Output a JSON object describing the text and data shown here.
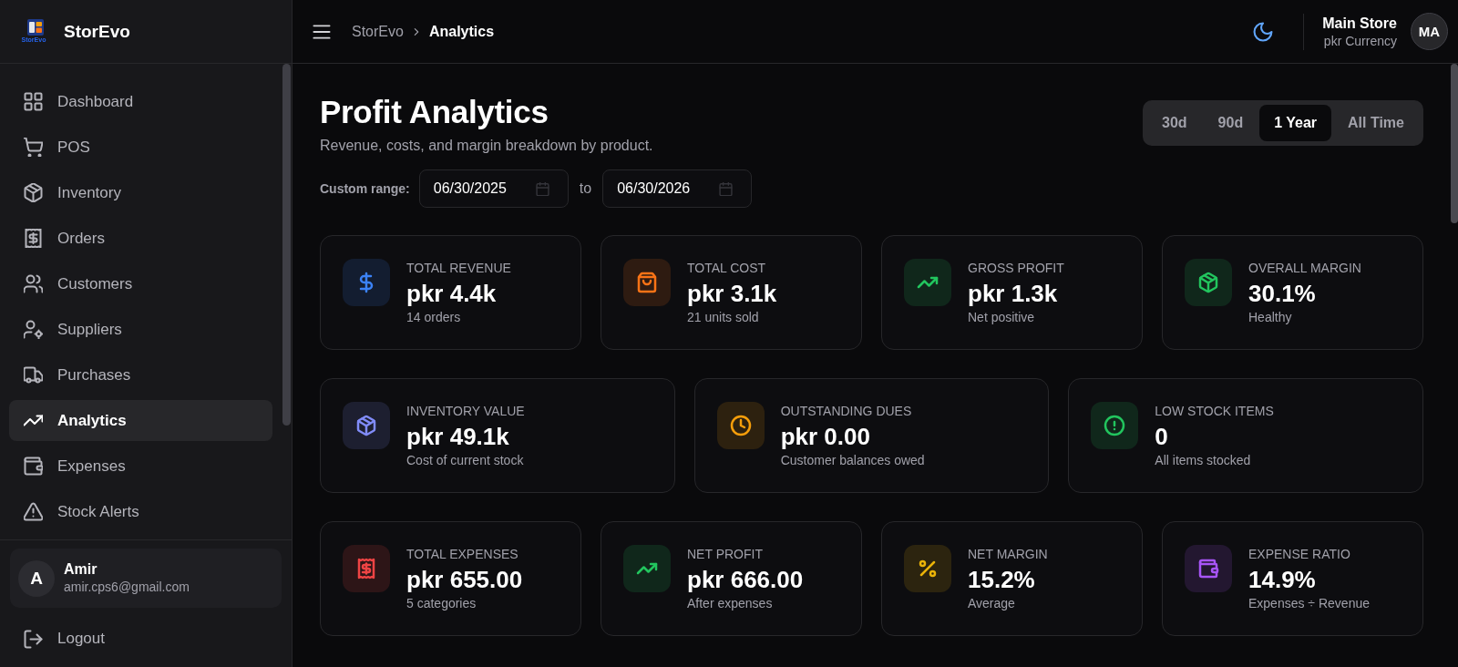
{
  "sidebar": {
    "brand": {
      "logo_caption": "StorEvo",
      "name": "StorEvo"
    },
    "nav": [
      {
        "label": "Dashboard",
        "selected": false
      },
      {
        "label": "POS",
        "selected": false
      },
      {
        "label": "Inventory",
        "selected": false
      },
      {
        "label": "Orders",
        "selected": false
      },
      {
        "label": "Customers",
        "selected": false
      },
      {
        "label": "Suppliers",
        "selected": false
      },
      {
        "label": "Purchases",
        "selected": false
      },
      {
        "label": "Analytics",
        "selected": true
      },
      {
        "label": "Expenses",
        "selected": false
      },
      {
        "label": "Stock Alerts",
        "selected": false
      }
    ],
    "user": {
      "initial": "A",
      "name": "Amir",
      "email": "amir.cps6@gmail.com"
    },
    "logout": "Logout"
  },
  "header": {
    "breadcrumb": [
      "StorEvo",
      "Analytics"
    ],
    "store": {
      "name": "Main Store",
      "currency": "pkr Currency"
    },
    "avatar": "MA"
  },
  "page": {
    "title": "Profit Analytics",
    "subtitle": "Revenue, costs, and margin breakdown by product.",
    "custom_range": {
      "label": "Custom range:",
      "from": "06/30/2025",
      "separator": "to",
      "to": "06/30/2026"
    },
    "periods": [
      {
        "label": "30d",
        "selected": false
      },
      {
        "label": "90d",
        "selected": false
      },
      {
        "label": "1 Year",
        "selected": true
      },
      {
        "label": "All Time",
        "selected": false
      }
    ]
  },
  "metric_rows": [
    {
      "cards": [
        {
          "label": "TOTAL REVENUE",
          "value": "pkr 4.4k",
          "note": "14 orders",
          "color": "#3b82f6"
        },
        {
          "label": "TOTAL COST",
          "value": "pkr 3.1k",
          "note": "21 units sold",
          "color": "#f97316"
        },
        {
          "label": "GROSS PROFIT",
          "value": "pkr 1.3k",
          "note": "Net positive",
          "color": "#22c55e"
        },
        {
          "label": "OVERALL MARGIN",
          "value": "30.1%",
          "note": "Healthy",
          "color": "#22c55e"
        }
      ]
    },
    {
      "cards": [
        {
          "label": "INVENTORY VALUE",
          "value": "pkr 49.1k",
          "note": "Cost of current stock",
          "color": "#818cf8"
        },
        {
          "label": "OUTSTANDING DUES",
          "value": "pkr 0.00",
          "note": "Customer balances owed",
          "color": "#f59e0b"
        },
        {
          "label": "LOW STOCK ITEMS",
          "value": "0",
          "note": "All items stocked",
          "color": "#22c55e"
        }
      ]
    },
    {
      "cards": [
        {
          "label": "TOTAL EXPENSES",
          "value": "pkr 655.00",
          "note": "5 categories",
          "color": "#ef4444"
        },
        {
          "label": "NET PROFIT",
          "value": "pkr 666.00",
          "note": "After expenses",
          "color": "#22c55e"
        },
        {
          "label": "NET MARGIN",
          "value": "15.2%",
          "note": "Average",
          "color": "#eab308"
        },
        {
          "label": "EXPENSE RATIO",
          "value": "14.9%",
          "note": "Expenses ÷ Revenue",
          "color": "#a855f7"
        }
      ]
    }
  ]
}
